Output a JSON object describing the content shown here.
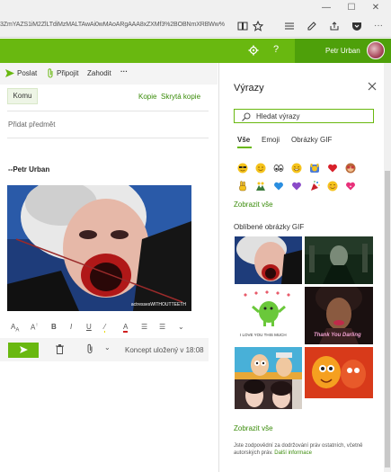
{
  "browser": {
    "url": "3ZmYAZS1iM2ZlLTdiMzMALTAwAi0wMAoARgAAA8xZXMf3%2BOBNmXRBWw%",
    "window_controls": [
      "minimize",
      "maximize",
      "close"
    ]
  },
  "header": {
    "user_name": "Petr Urban"
  },
  "compose": {
    "toolbar": {
      "send_label": "Poslat",
      "attach_label": "Připojit",
      "discard_label": "Zahodit",
      "more_label": "···"
    },
    "to_label": "Komu",
    "cc_label": "Kopie",
    "bcc_label": "Skrytá kopie",
    "subject_placeholder": "Přidat předmět",
    "signature": "--Petr Urban",
    "gif_watermark": "actressesWITHOUTTEETH",
    "format_icons": [
      "font-size",
      "font-grow",
      "bold",
      "italic",
      "underline",
      "highlight",
      "font-color",
      "bullets",
      "numbering",
      "more"
    ],
    "draft_status": "Koncept uložený v 18:08"
  },
  "expressions": {
    "title": "Výrazy",
    "search_placeholder": "Hledat výrazy",
    "tabs": [
      "Vše",
      "Emoji",
      "Obrázky GIF"
    ],
    "active_tab": 0,
    "emoji_row1": [
      "😎",
      "😊",
      "👀",
      "😄",
      "🙌",
      "❤",
      "🙈"
    ],
    "emoji_row2": [
      "✌",
      "👯",
      "💙",
      "💜",
      "🎉",
      "😊",
      "💗"
    ],
    "show_all_1": "Zobrazit vše",
    "gif_section_title": "Oblíbené obrázky GIF",
    "gif_captions": {
      "gif3": "I LOVE YOU THIS MUCH",
      "gif4": "Thank You Darling"
    },
    "show_all_2": "Zobrazit vše",
    "footer_text": "Jste zodpovědní za dodržování práv ostatních, včetně autorských práv.",
    "footer_link": "Další informace"
  },
  "colors": {
    "accent": "#69b810",
    "header_dark": "#4ea00a",
    "link": "#3a8c0a"
  }
}
